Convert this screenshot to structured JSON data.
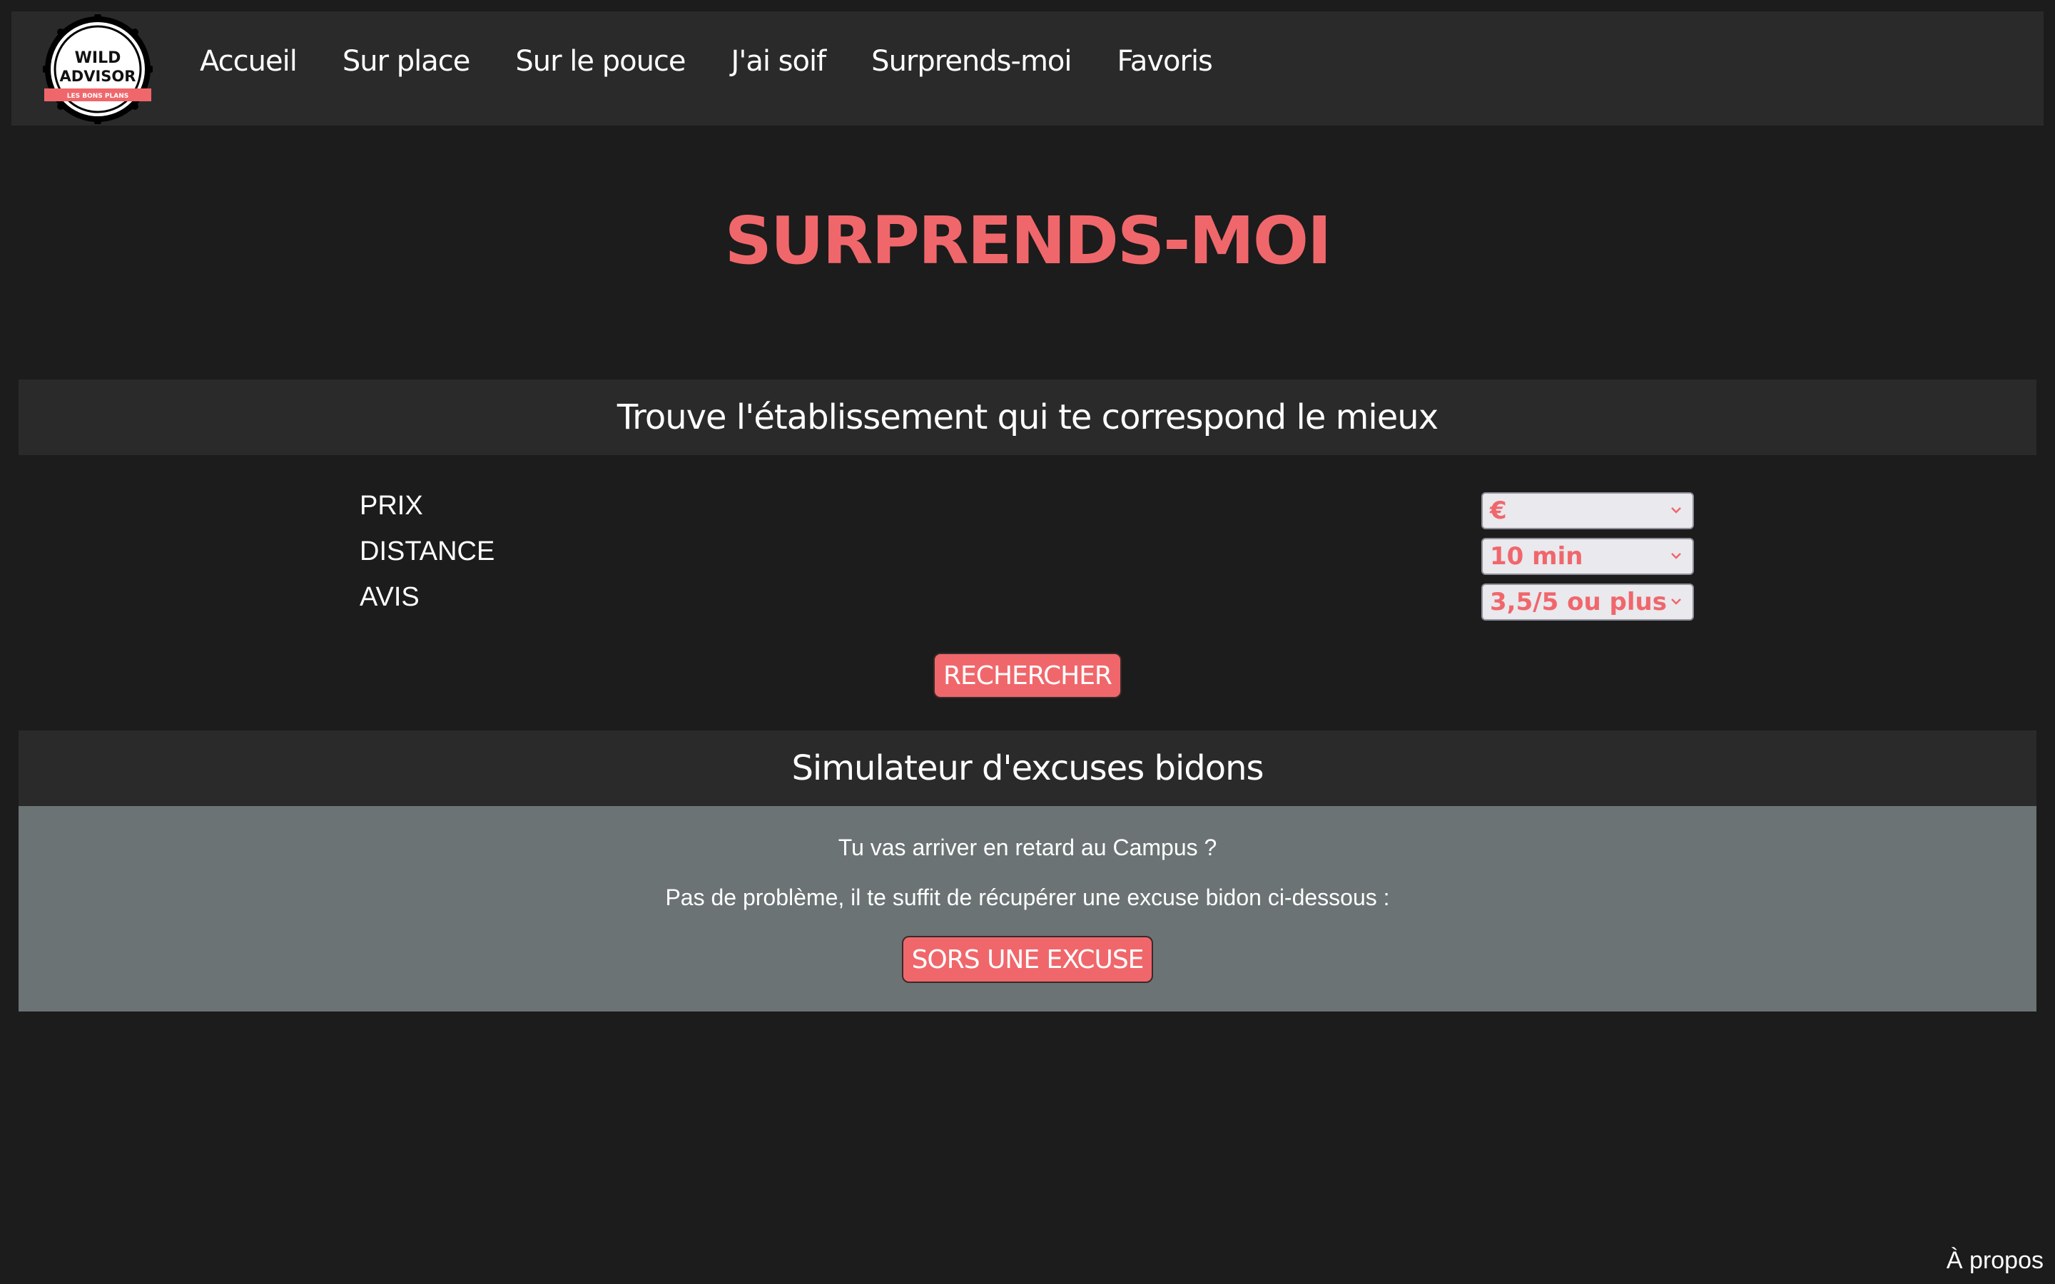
{
  "logo": {
    "line1": "WILD",
    "line2": "ADVISOR",
    "ribbon": "LES BONS PLANS"
  },
  "nav": {
    "items": [
      {
        "label": "Accueil"
      },
      {
        "label": "Sur place"
      },
      {
        "label": "Sur le pouce"
      },
      {
        "label": "J'ai soif"
      },
      {
        "label": "Surprends-moi"
      },
      {
        "label": "Favoris"
      }
    ]
  },
  "page": {
    "title": "SURPRENDS-MOI"
  },
  "search": {
    "heading": "Trouve l'établissement qui te correspond le mieux",
    "filters": [
      {
        "label": "PRIX",
        "value": "€"
      },
      {
        "label": "DISTANCE",
        "value": "10 min"
      },
      {
        "label": "AVIS",
        "value": "3,5/5 ou plus"
      }
    ],
    "button_label": "RECHERCHER"
  },
  "excuse": {
    "heading": "Simulateur d'excuses bidons",
    "line1": "Tu vas arriver en retard au Campus ?",
    "line2": "Pas de problème, il te suffit de récupérer une excuse bidon ci-dessous :",
    "button_label": "SORS UNE EXCUSE"
  },
  "footer": {
    "about_label": "À propos"
  },
  "colors": {
    "accent": "#f0676b",
    "background": "#1c1c1c",
    "panel": "#2a2a2a",
    "excuse_panel": "#6b7374"
  }
}
